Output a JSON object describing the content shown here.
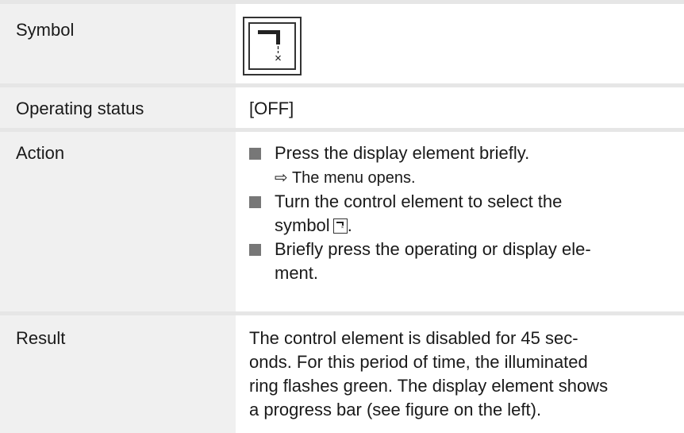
{
  "rows": {
    "symbol": {
      "label": "Symbol"
    },
    "status": {
      "label": "Operating status",
      "value": "[OFF]"
    },
    "action": {
      "label": "Action",
      "item1": "Press the display element briefly.",
      "item1_result": "⇨ The menu opens.",
      "item2_line1": "Turn the control element to select the",
      "item2_line2": "symbol",
      "item2_end": ".",
      "item3_line1": "Briefly press the operating or display ele-",
      "item3_line2": "ment."
    },
    "result": {
      "label": "Result",
      "line1": "The control element is disabled for 45 sec-",
      "line2": "onds. For this period of time, the illuminated",
      "line3": "ring flashes green. The display element shows",
      "line4": "a progress bar (see figure on the left)."
    }
  },
  "icons": {
    "symbol": "lock-control-icon"
  },
  "colors": {
    "label_bg": "#f0f0f0",
    "separator": "#e6e6e6",
    "bullet": "#777777"
  }
}
